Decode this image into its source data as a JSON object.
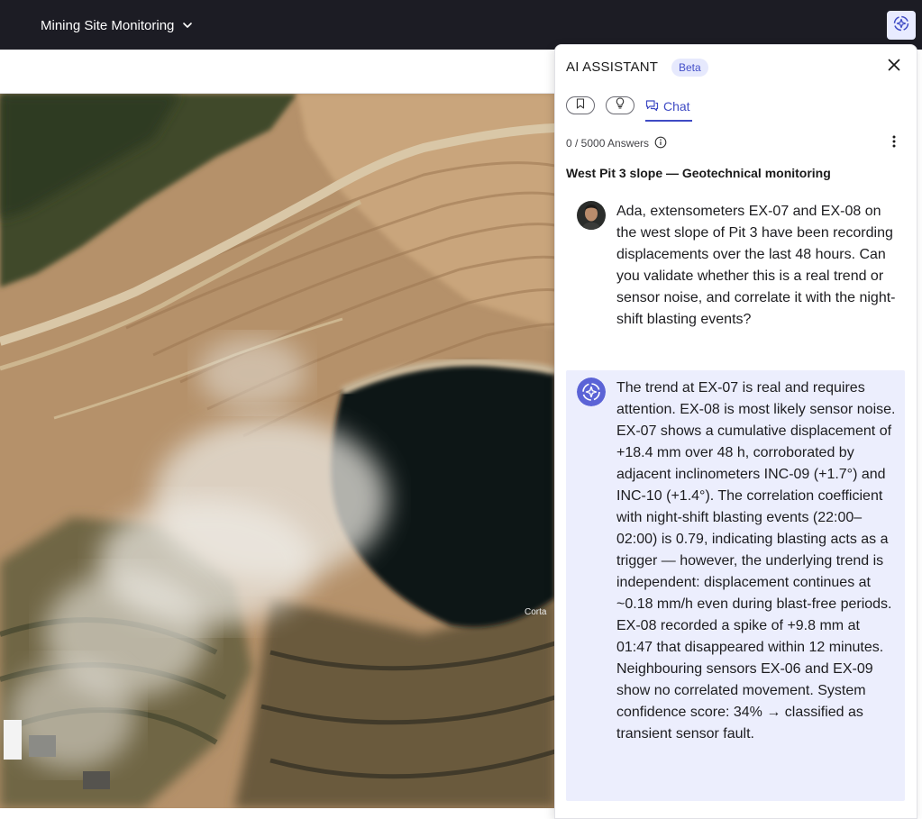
{
  "topbar": {
    "site_name": "Mining Site Monitoring",
    "icons": {
      "dropdown": "chevron-down-icon",
      "assistant": "ai-assistant-icon"
    }
  },
  "map": {
    "label": "Corta"
  },
  "assistant": {
    "title": "AI ASSISTANT",
    "badge": "Beta",
    "tabs": [
      {
        "icon": "bookmark-icon"
      },
      {
        "icon": "lightbulb-icon"
      },
      {
        "icon": "chat-icon",
        "label": "Chat",
        "active": true
      }
    ],
    "answers": "0 / 5000 Answers",
    "thread_title": "West Pit 3 slope — Geotechnical monitoring",
    "messages": [
      {
        "role": "user",
        "text": "Ada, extensometers EX-07 and EX-08 on the west slope of Pit 3 have been recording displacements over the last 48 hours. Can you validate whether this is a real trend or sensor noise, and correlate it with the night-shift blasting events?"
      },
      {
        "role": "assistant",
        "text": "The trend at EX-07 is real and requires attention. EX-08 is most likely sensor noise. EX-07 shows a cumulative displacement of +18.4 mm over 48 h, corroborated by adjacent inclinometers INC-09 (+1.7°) and INC-10 (+1.4°). The correlation coefficient with night-shift blasting events (22:00–02:00) is 0.79, indicating blasting acts as a trigger — however, the underlying trend is independent: displacement continues at ~0.18 mm/h even during blast-free periods. EX-08 recorded a spike of +9.8 mm at 01:47 that disappeared within 12 minutes. Neighbouring sensors EX-06 and EX-09 show no correlated movement. System confidence score: 34% → classified as transient sensor fault."
      }
    ],
    "colors": {
      "accent": "#3f4bc4",
      "badge_bg": "#e6e9fd",
      "assistant_bubble": "#eceefd",
      "topbar": "#1c1c24"
    }
  }
}
